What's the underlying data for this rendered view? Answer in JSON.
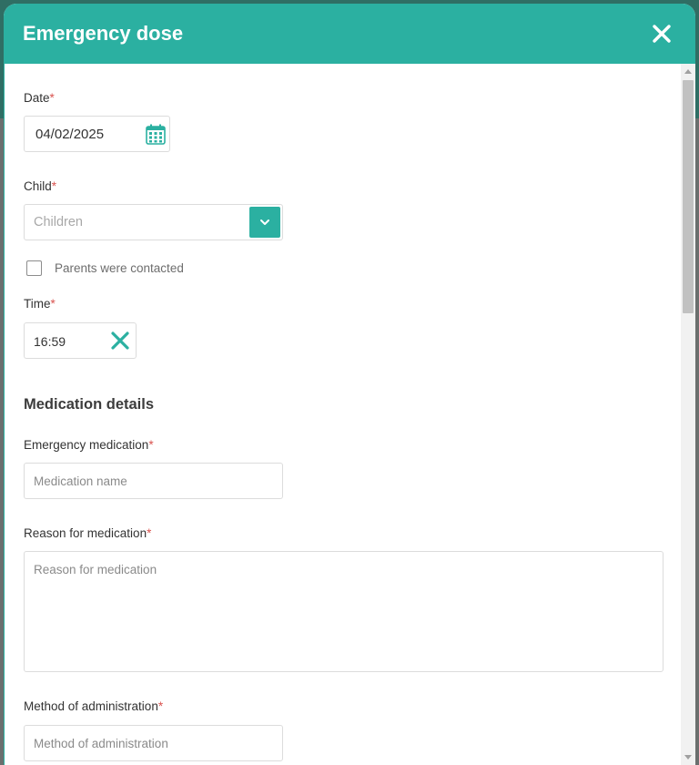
{
  "modal": {
    "title": "Emergency dose"
  },
  "form": {
    "date": {
      "label": "Date",
      "value": "04/02/2025"
    },
    "child": {
      "label": "Child",
      "placeholder": "Children"
    },
    "parents_contacted": {
      "label": "Parents were contacted",
      "checked": false
    },
    "time": {
      "label": "Time",
      "value": "16:59"
    },
    "section_title": "Medication details",
    "medication": {
      "label": "Emergency medication",
      "placeholder": "Medication name"
    },
    "reason": {
      "label": "Reason for medication",
      "placeholder": "Reason for medication"
    },
    "method": {
      "label": "Method of administration",
      "placeholder": "Method of administration"
    },
    "required_mark": "*"
  },
  "colors": {
    "accent": "#2bb0a1",
    "required": "#d9534f"
  },
  "icons": {
    "close": "close-icon",
    "calendar": "calendar-icon",
    "dropdown": "chevron-down-icon",
    "clear": "clear-x-icon"
  }
}
